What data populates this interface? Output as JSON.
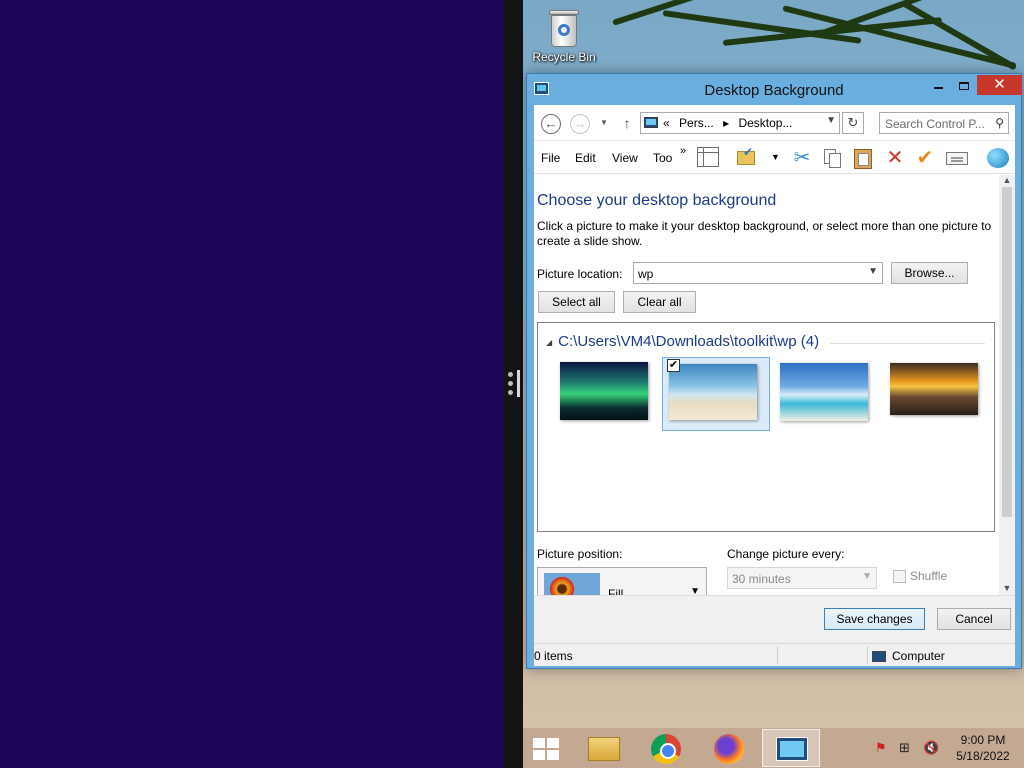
{
  "desktop": {
    "recycle_bin_label": "Recycle Bin"
  },
  "window": {
    "title": "Desktop Background",
    "caption_buttons": {
      "minimize": "minimize",
      "maximize": "maximize",
      "close": "✕"
    }
  },
  "nav": {
    "breadcrumbs": [
      "«",
      "Pers...",
      "▸",
      "Desktop..."
    ],
    "search_placeholder": "Search Control P..."
  },
  "menu": {
    "items": [
      "File",
      "Edit",
      "View",
      "Too"
    ],
    "overflow": "»"
  },
  "toolbar_icons": [
    "pane-icon",
    "folder-check-icon",
    "cut-icon",
    "copy-icon",
    "paste-icon",
    "delete-icon",
    "check-icon",
    "properties-icon",
    "web-icon"
  ],
  "content": {
    "heading": "Choose your desktop background",
    "description": "Click a picture to make it your desktop background, or select more than one picture to create a slide show.",
    "picture_location_label": "Picture location:",
    "picture_location_value": "wp",
    "browse_label": "Browse...",
    "select_all_label": "Select all",
    "clear_all_label": "Clear all",
    "group_header": "C:\\Users\\VM4\\Downloads\\toolkit\\wp (4)",
    "thumbnails": [
      {
        "name": "aurora-forest",
        "selected": false
      },
      {
        "name": "palm-beach",
        "selected": true
      },
      {
        "name": "tropical-island",
        "selected": false
      },
      {
        "name": "sunset-pier",
        "selected": false
      }
    ],
    "picture_position_label": "Picture position:",
    "picture_position_value": "Fill",
    "change_picture_label": "Change picture every:",
    "change_picture_value": "30 minutes",
    "shuffle_label": "Shuffle"
  },
  "buttons": {
    "save_label": "Save changes",
    "cancel_label": "Cancel"
  },
  "status": {
    "items": "0 items",
    "location": "Computer"
  },
  "taskbar": {
    "apps": [
      "file-explorer",
      "chrome",
      "firefox",
      "control-panel"
    ],
    "time": "9:00 PM",
    "date": "5/18/2022"
  }
}
